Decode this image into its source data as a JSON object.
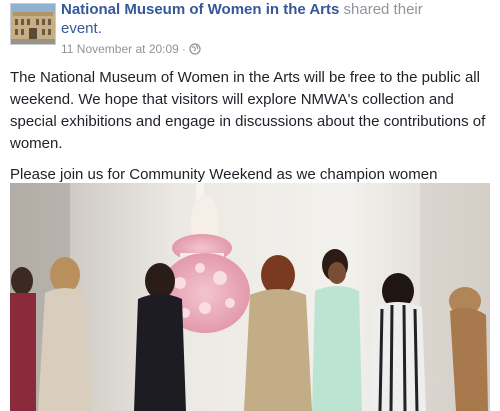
{
  "post": {
    "page_name": "National Museum of Women in the Arts",
    "shared_text": " shared their",
    "event_link": "event.",
    "timestamp": "11 November at 20:09",
    "separator": "·",
    "privacy_icon": "globe-icon",
    "paragraphs": [
      "The National Museum of Women in the Arts will be free to the public all weekend. We hope that visitors will explore NMWA's collection and special exhibitions and engage in discussions about the contributions of women.",
      "Please join us for Community Weekend as we champion women through the arts with a renewed commitment."
    ]
  },
  "colors": {
    "link": "#365899",
    "meta": "#90949c",
    "text": "#1d2129"
  }
}
